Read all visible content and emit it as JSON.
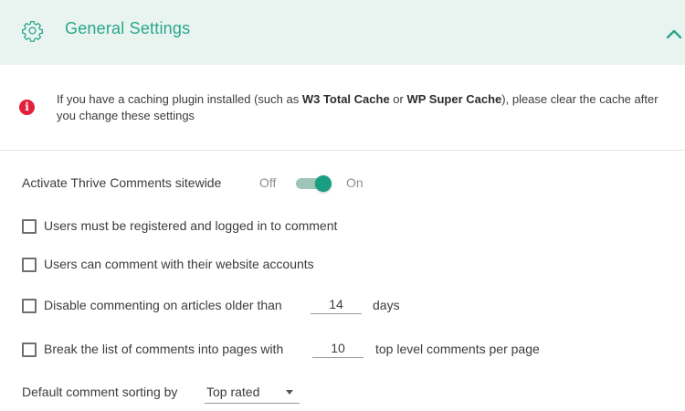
{
  "header": {
    "title": "General Settings",
    "icon": "gear-icon",
    "collapse_icon": "chevron-up-icon",
    "accent_color": "#2aa58a",
    "background": "#e9f4f1"
  },
  "notice": {
    "icon": "info-icon",
    "icon_color": "#e3203b",
    "text_before": "If you have a caching plugin installed (such as ",
    "plugin1": "W3 Total Cache",
    "text_or": " or ",
    "plugin2": "WP Super Cache",
    "text_after": "), please clear the cache after you change these settings"
  },
  "settings": {
    "activate": {
      "label": "Activate Thrive Comments sitewide",
      "off_label": "Off",
      "on_label": "On",
      "state": "on"
    },
    "registered": {
      "label": "Users must be registered and logged in to comment",
      "checked": false
    },
    "website_accounts": {
      "label": "Users can comment with their website accounts",
      "checked": false
    },
    "disable_old": {
      "label": "Disable commenting on articles older than",
      "value": "14",
      "suffix": "days",
      "checked": false
    },
    "pagination": {
      "label": "Break the list of comments into pages with",
      "value": "10",
      "suffix": "top level comments per page",
      "checked": false
    },
    "sorting": {
      "label": "Default comment sorting by",
      "selected": "Top rated"
    }
  }
}
